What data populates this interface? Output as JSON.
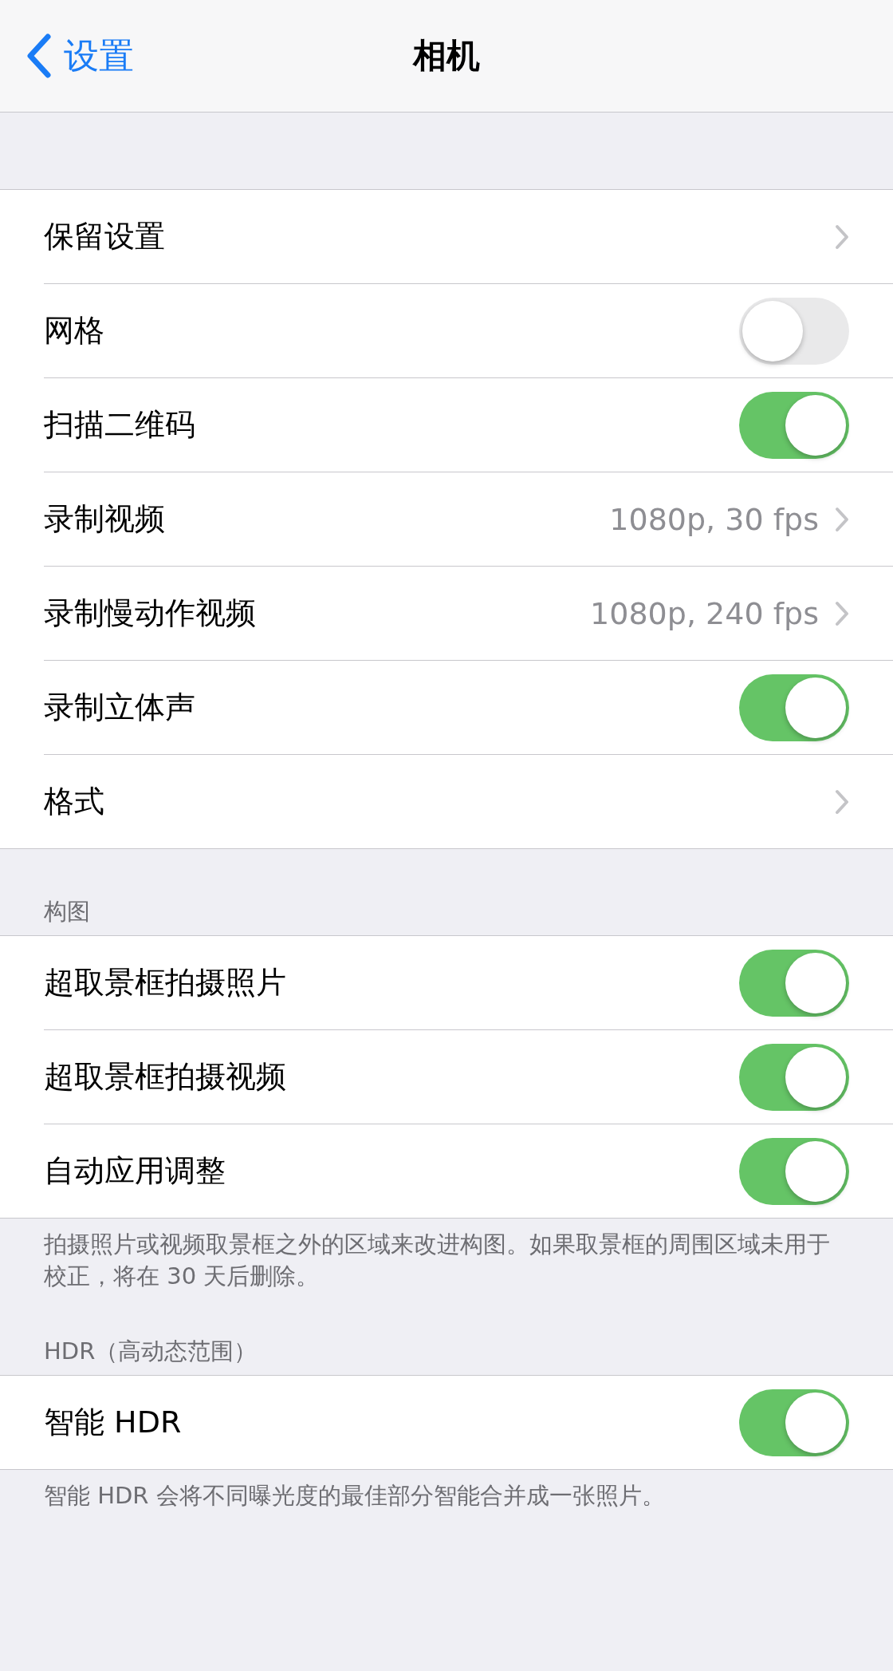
{
  "nav": {
    "back_label": "设置",
    "title": "相机"
  },
  "groups": [
    {
      "rows": [
        {
          "kind": "link",
          "label": "保留设置"
        },
        {
          "kind": "toggle",
          "label": "网格",
          "on": false
        },
        {
          "kind": "toggle",
          "label": "扫描二维码",
          "on": true
        },
        {
          "kind": "link",
          "label": "录制视频",
          "value": "1080p, 30 fps"
        },
        {
          "kind": "link",
          "label": "录制慢动作视频",
          "value": "1080p, 240 fps"
        },
        {
          "kind": "toggle",
          "label": "录制立体声",
          "on": true
        },
        {
          "kind": "link",
          "label": "格式"
        }
      ]
    },
    {
      "header": "构图",
      "rows": [
        {
          "kind": "toggle",
          "label": "超取景框拍摄照片",
          "on": true
        },
        {
          "kind": "toggle",
          "label": "超取景框拍摄视频",
          "on": true
        },
        {
          "kind": "toggle",
          "label": "自动应用调整",
          "on": true
        }
      ],
      "footer": "拍摄照片或视频取景框之外的区域来改进构图。如果取景框的周围区域未用于校正，将在 30 天后删除。"
    },
    {
      "header": "HDR（高动态范围）",
      "rows": [
        {
          "kind": "toggle",
          "label": "智能 HDR",
          "on": true
        }
      ],
      "footer": "智能 HDR 会将不同曝光度的最佳部分智能合并成一张照片。"
    }
  ]
}
